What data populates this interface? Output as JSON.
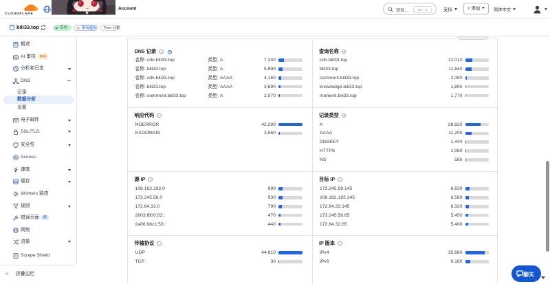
{
  "topnav": {
    "brand": "CLOUDFLARE",
    "account_label": "Account",
    "search_placeholder": "转到...",
    "search_shortcut": "ctrl + K",
    "support_label": "支持",
    "add_label": "+ 添加",
    "language_label": "简体中文"
  },
  "domainbar": {
    "domain": "bili33.top",
    "active_badge": "活动",
    "starred_badge": "带有星标",
    "plan_badge": "Free 计划"
  },
  "sidebar": {
    "items": [
      {
        "label": "概述"
      },
      {
        "label": "AI 审核",
        "badge": "Beta"
      },
      {
        "label": "分析和日志",
        "caret": true
      },
      {
        "label": "DNS",
        "expanded": true
      },
      {
        "label": "记录",
        "sub": true
      },
      {
        "label": "数据分析",
        "sub": true,
        "selected": true
      },
      {
        "label": "设置",
        "sub": true
      },
      {
        "label": "电子邮件",
        "caret": true
      },
      {
        "label": "SSL/TLS",
        "caret": true
      },
      {
        "label": "安全性",
        "caret": true
      },
      {
        "label": "Access"
      },
      {
        "label": "速度",
        "caret": true
      },
      {
        "label": "缓存",
        "caret": true
      },
      {
        "label": "Workers 路由"
      },
      {
        "label": "规则",
        "caret": true
      },
      {
        "label": "错误页面",
        "badge": "新"
      },
      {
        "label": "网络"
      },
      {
        "label": "流量",
        "caret": true
      },
      {
        "label": "Scrape Shield"
      }
    ],
    "collapse_label": "折叠边栏"
  },
  "cards": {
    "dns_records": {
      "title": "DNS 记录",
      "rows": [
        {
          "name_label": "名称:",
          "name": "cdn.bili33.top",
          "type_label": "类型:",
          "type": "A",
          "value": "7,330",
          "pct": 22
        },
        {
          "name_label": "名称:",
          "name": "bili33.top",
          "type_label": "类型:",
          "type": "A",
          "value": "5,890",
          "pct": 17
        },
        {
          "name_label": "名称:",
          "name": "cdn.bili33.top",
          "type_label": "类型:",
          "type": "AAAA",
          "value": "4,160",
          "pct": 11
        },
        {
          "name_label": "名称:",
          "name": "bili33.top",
          "type_label": "类型:",
          "type": "AAAA",
          "value": "3,690",
          "pct": 10
        },
        {
          "name_label": "名称:",
          "name": "comment.bili33.top",
          "type_label": "类型:",
          "type": "A",
          "value": "2,070",
          "pct": 5
        }
      ]
    },
    "query_name": {
      "title": "查询名称",
      "rows": [
        {
          "label": "cdn.bili33.top",
          "value": "12,010",
          "pct": 31
        },
        {
          "label": "bili33.top",
          "value": "11,640",
          "pct": 28
        },
        {
          "label": "comment.bili33.top",
          "value": "2,080",
          "pct": 6
        },
        {
          "label": "knowledge.bili33.top",
          "value": "1,890",
          "pct": 5
        },
        {
          "label": "moment.bili33.top",
          "value": "1,770",
          "pct": 5
        }
      ]
    },
    "response_code": {
      "title": "响应代码",
      "rows": [
        {
          "label": "NOERROR",
          "value": "42,280",
          "pct": 100
        },
        {
          "label": "NXDOMAIN",
          "value": "2,560",
          "pct": 6
        }
      ]
    },
    "record_type": {
      "title": "记录类型",
      "rows": [
        {
          "label": "A",
          "value": "28,830",
          "pct": 65
        },
        {
          "label": "AAAA",
          "value": "11,200",
          "pct": 28
        },
        {
          "label": "DNSKEY",
          "value": "1,440",
          "pct": 4
        },
        {
          "label": "HTTPS",
          "value": "1,080",
          "pct": 3
        },
        {
          "label": "NS",
          "value": "580",
          "pct": 2
        }
      ]
    },
    "source_ip": {
      "title": "源 IP",
      "rows": [
        {
          "label": "108.162.192.0",
          "value": "990",
          "pct": 17
        },
        {
          "label": "173.245.58.0",
          "value": "930",
          "pct": 16
        },
        {
          "label": "172.64.32.0",
          "value": "790",
          "pct": 14
        },
        {
          "label": "2803:f800:53::",
          "value": "470",
          "pct": 9
        },
        {
          "label": "2a06:98c1:53::",
          "value": "440",
          "pct": 8
        }
      ]
    },
    "destination_ip": {
      "title": "目标 IP",
      "rows": [
        {
          "label": "173.245.59.145",
          "value": "6,630",
          "pct": 17.5
        },
        {
          "label": "108.162.193.145",
          "value": "6,580",
          "pct": 16.5
        },
        {
          "label": "172.64.33.145",
          "value": "6,330",
          "pct": 15.5
        },
        {
          "label": "173.245.58.65",
          "value": "5,450",
          "pct": 12.5
        },
        {
          "label": "172.64.32.65",
          "value": "5,400",
          "pct": 12.5
        }
      ]
    },
    "transport": {
      "title": "传输协议",
      "rows": [
        {
          "label": "UDP",
          "value": "44,810",
          "pct": 100
        },
        {
          "label": "TCP",
          "value": "30",
          "pct": 0.8
        }
      ]
    },
    "ip_version": {
      "title": "IP 版本",
      "rows": [
        {
          "label": "IPv4",
          "value": "35,680",
          "pct": 84
        },
        {
          "label": "IPv6",
          "value": "9,160",
          "pct": 23
        }
      ]
    }
  },
  "chat_label": "聊天",
  "chart_data": [
    {
      "type": "bar",
      "title": "DNS 记录",
      "categories": [
        "cdn.bili33.top A",
        "bili33.top A",
        "cdn.bili33.top AAAA",
        "bili33.top AAAA",
        "comment.bili33.top A"
      ],
      "values": [
        7330,
        5890,
        4160,
        3690,
        2070
      ]
    },
    {
      "type": "bar",
      "title": "查询名称",
      "categories": [
        "cdn.bili33.top",
        "bili33.top",
        "comment.bili33.top",
        "knowledge.bili33.top",
        "moment.bili33.top"
      ],
      "values": [
        12010,
        11640,
        2080,
        1890,
        1770
      ]
    },
    {
      "type": "bar",
      "title": "响应代码",
      "categories": [
        "NOERROR",
        "NXDOMAIN"
      ],
      "values": [
        42280,
        2560
      ]
    },
    {
      "type": "bar",
      "title": "记录类型",
      "categories": [
        "A",
        "AAAA",
        "DNSKEY",
        "HTTPS",
        "NS"
      ],
      "values": [
        28830,
        11200,
        1440,
        1080,
        580
      ]
    },
    {
      "type": "bar",
      "title": "源 IP",
      "categories": [
        "108.162.192.0",
        "173.245.58.0",
        "172.64.32.0",
        "2803:f800:53::",
        "2a06:98c1:53::"
      ],
      "values": [
        990,
        930,
        790,
        470,
        440
      ]
    },
    {
      "type": "bar",
      "title": "目标 IP",
      "categories": [
        "173.245.59.145",
        "108.162.193.145",
        "172.64.33.145",
        "173.245.58.65",
        "172.64.32.65"
      ],
      "values": [
        6630,
        6580,
        6330,
        5450,
        5400
      ]
    },
    {
      "type": "bar",
      "title": "传输协议",
      "categories": [
        "UDP",
        "TCP"
      ],
      "values": [
        44810,
        30
      ]
    },
    {
      "type": "bar",
      "title": "IP 版本",
      "categories": [
        "IPv4",
        "IPv6"
      ],
      "values": [
        35680,
        9160
      ]
    }
  ]
}
